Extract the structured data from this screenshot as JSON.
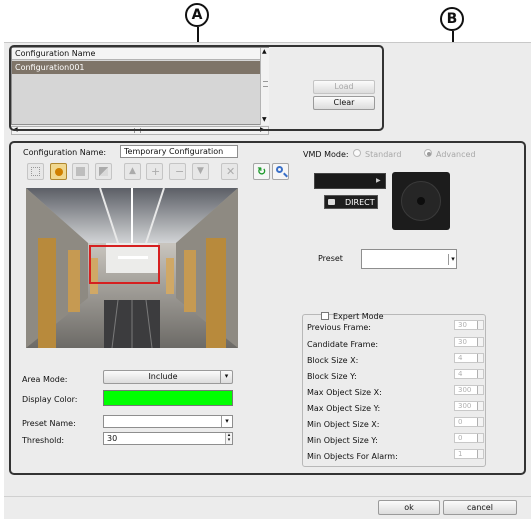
{
  "callouts": {
    "a": "A",
    "b": "B"
  },
  "config_list": {
    "header": "Configuration Name",
    "items": [
      "Configuration001"
    ],
    "load_label": "Load",
    "clear_label": "Clear"
  },
  "config_name": {
    "label": "Configuration Name:",
    "value": "Temporary Configuration"
  },
  "vmd_mode": {
    "label": "VMD Mode:",
    "options": [
      "Standard",
      "Advanced"
    ],
    "selected": "Advanced"
  },
  "ptz": {
    "direct_label": "DIRECT"
  },
  "preset": {
    "label": "Preset",
    "value": ""
  },
  "expert": {
    "title": "Expert Mode",
    "checked": false,
    "params": [
      {
        "label": "Previous Frame:",
        "value": "30"
      },
      {
        "label": "Candidate Frame:",
        "value": "30"
      },
      {
        "label": "Block Size X:",
        "value": "4"
      },
      {
        "label": "Block Size Y:",
        "value": "4"
      },
      {
        "label": "Max Object Size X:",
        "value": "300"
      },
      {
        "label": "Max Object Size Y:",
        "value": "300"
      },
      {
        "label": "Min Object Size X:",
        "value": "0"
      },
      {
        "label": "Min Object Size Y:",
        "value": "0"
      },
      {
        "label": "Min Objects For Alarm:",
        "value": "1"
      }
    ]
  },
  "area_mode": {
    "label": "Area Mode:",
    "value": "Include"
  },
  "display_color": {
    "label": "Display Color:",
    "color": "#00ff00"
  },
  "preset_name": {
    "label": "Preset Name:",
    "value": ""
  },
  "threshold": {
    "label": "Threshold:",
    "value": "30"
  },
  "footer": {
    "ok_label": "ok",
    "cancel_label": "cancel"
  },
  "colors": {
    "accent_selection": "#7e7468",
    "detection_box": "#d62020",
    "panel_bg": "#ececec"
  }
}
